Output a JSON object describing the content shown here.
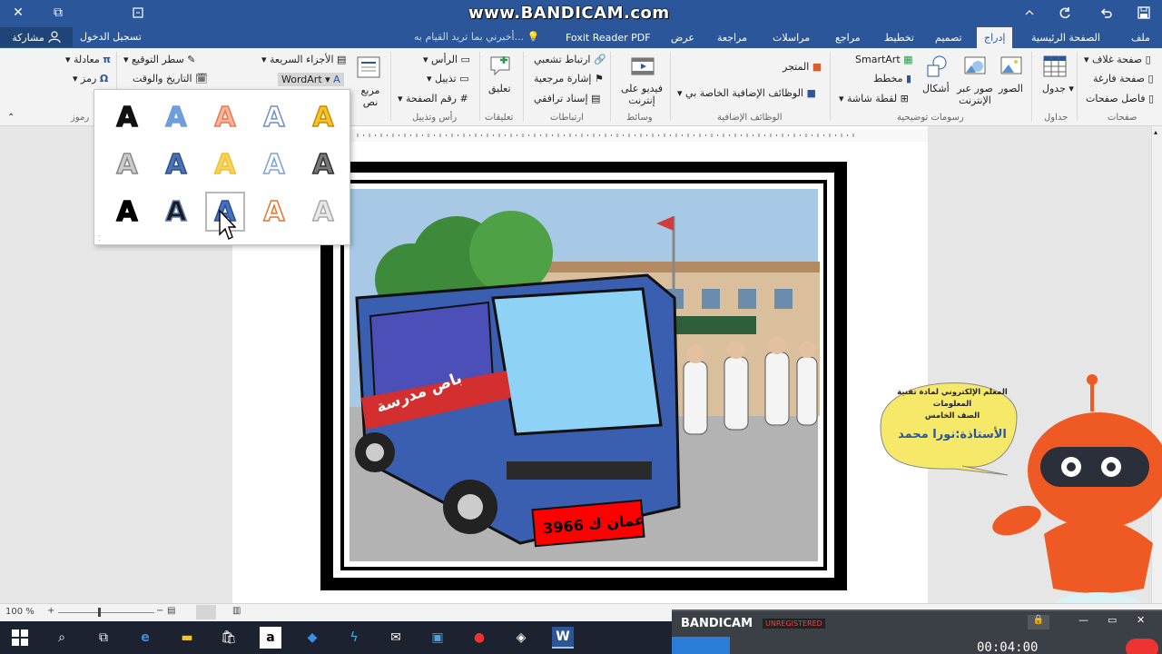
{
  "titlebar": {
    "watermark": "www.BANDICAM.com",
    "close_glyph": "✕",
    "restore_glyph": "⧉",
    "minimize_glyph": "—"
  },
  "tabs": {
    "items": [
      "ملف",
      "الصفحة الرئيسية",
      "إدراج",
      "تصميم",
      "تخطيط",
      "مراجع",
      "مراسلات",
      "مراجعة",
      "عرض",
      "Foxit Reader PDF"
    ],
    "active": "إدراج",
    "tell_me": "أخبرني بما تريد القيام به...",
    "login": "تسجيل الدخول",
    "share": "مشاركة"
  },
  "ribbon": {
    "pages": {
      "label": "صفحات",
      "cover": "صفحة غلاف",
      "blank": "صفحة فارغة",
      "break": "فاصل صفحات"
    },
    "tables": {
      "label": "جداول",
      "table": "جدول"
    },
    "illustrations": {
      "label": "رسومات توضيحية",
      "pictures": "الصور",
      "online_pictures": "صور عبر الإنترنت",
      "shapes": "أشكال",
      "smartart": "SmartArt",
      "chart": "مخطط",
      "screenshot": "لقطة شاشة"
    },
    "addins": {
      "label": "الوظائف الإضافية",
      "store": "المتجر",
      "my_addins": "الوظائف الإضافية الخاصة بي"
    },
    "media": {
      "label": "وسائط",
      "online_video": "فيديو على إنترنت"
    },
    "links": {
      "label": "ارتباطات",
      "hyperlink": "ارتباط تشعبي",
      "bookmark": "إشارة مرجعية",
      "cross_ref": "إسناد ترافقي"
    },
    "comments": {
      "label": "تعليقات",
      "comment": "تعليق"
    },
    "header_footer": {
      "label": "رأس وتذييل",
      "header": "الرأس",
      "footer": "تذييل",
      "page_number": "رقم الصفحة"
    },
    "text": {
      "text_box": "مربع نص",
      "quick_parts": "الأجزاء السريعة",
      "wordart": "WordArt",
      "signature": "سطر التوقيع",
      "datetime": "التاريخ والوقت"
    },
    "symbols": {
      "label": "رموز",
      "equation": "معادلة",
      "symbol": "رمز"
    }
  },
  "gallery": {
    "letter": "A",
    "styles": [
      {
        "fill": "#f2c230",
        "stroke": "#c98f00"
      },
      {
        "fill": "#ffffff",
        "stroke": "#6f8fc6"
      },
      {
        "fill": "#f8b59a",
        "stroke": "#e57a52"
      },
      {
        "fill": "#6e9fd8",
        "stroke": "#6e9fd8"
      },
      {
        "fill": "#111111",
        "stroke": "#111111"
      },
      {
        "fill": "#777777",
        "stroke": "#333333"
      },
      {
        "fill": "#ffffff",
        "stroke": "#7ba3d6"
      },
      {
        "fill": "#f7d35c",
        "stroke": "#f0c030"
      },
      {
        "fill": "#4a73b5",
        "stroke": "#2d4f8a"
      },
      {
        "fill": "#cccccc",
        "stroke": "#888888"
      },
      {
        "fill": "#e9e9e9",
        "stroke": "#aaaaaa"
      },
      {
        "fill": "#ffffff",
        "stroke": "#e5762b"
      },
      {
        "fill": "#4672c0",
        "stroke": "#2a4f8f"
      },
      {
        "fill": "#1a1a1a",
        "stroke": "#5d7fb8"
      },
      {
        "fill": "#000000",
        "stroke": "#000000"
      }
    ],
    "selected_index": 12
  },
  "picture": {
    "bus_text": "باص مدرسة",
    "plate": "3966 عمان ك"
  },
  "speech_bubble": {
    "line1": "المعلم الإلكتروني لمادة تقنية المعلومات",
    "line2": "الصف الخامس",
    "line3": "الأستاذة:نورا محمد"
  },
  "statusbar": {
    "zoom": "100 %"
  },
  "bandicam": {
    "brand": "BANDICAM",
    "status": "UNREGISTERED",
    "timer": "00:04:00"
  }
}
